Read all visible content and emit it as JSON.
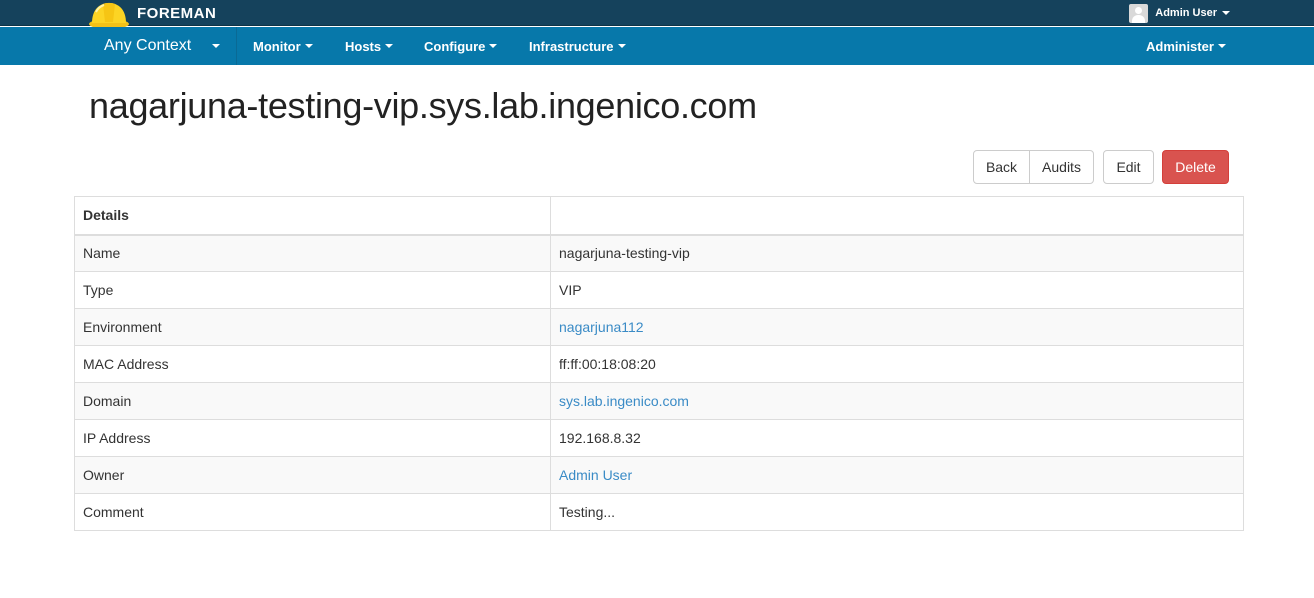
{
  "brand": {
    "name": "FOREMAN"
  },
  "user_menu": {
    "name": "Admin User"
  },
  "nav": {
    "context": "Any Context",
    "items": [
      {
        "label": "Monitor"
      },
      {
        "label": "Hosts"
      },
      {
        "label": "Configure"
      },
      {
        "label": "Infrastructure"
      }
    ],
    "administer": "Administer"
  },
  "page": {
    "title": "nagarjuna-testing-vip.sys.lab.ingenico.com"
  },
  "actions": {
    "back": "Back",
    "audits": "Audits",
    "edit": "Edit",
    "delete": "Delete"
  },
  "details": {
    "header": "Details",
    "rows": [
      {
        "label": "Name",
        "value": "nagarjuna-testing-vip"
      },
      {
        "label": "Type",
        "value": "VIP"
      },
      {
        "label": "Environment",
        "value": "nagarjuna112"
      },
      {
        "label": "MAC Address",
        "value": "ff:ff:00:18:08:20"
      },
      {
        "label": "Domain",
        "value": "sys.lab.ingenico.com"
      },
      {
        "label": "IP Address",
        "value": "192.168.8.32"
      },
      {
        "label": "Owner",
        "value": "Admin User"
      },
      {
        "label": "Comment",
        "value": "Testing..."
      }
    ]
  },
  "colors": {
    "topbar": "#15425c",
    "navbar": "#0778aa",
    "link": "#3a8bc6",
    "danger": "#d9534f"
  }
}
